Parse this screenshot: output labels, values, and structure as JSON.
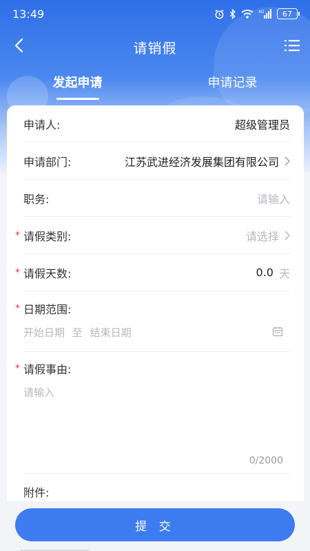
{
  "status_bar": {
    "time": "13:49",
    "battery": "67",
    "icons": [
      "alarm-icon",
      "bluetooth-icon",
      "wifi-icon",
      "signal-icon",
      "battery-icon"
    ]
  },
  "nav": {
    "title": "请销假",
    "back_icon": "chevron-left-icon",
    "menu_icon": "list-menu-icon"
  },
  "tabs": [
    {
      "label": "发起申请",
      "active": true
    },
    {
      "label": "申请记录",
      "active": false
    }
  ],
  "form": {
    "applicant": {
      "label": "申请人:",
      "value": "超级管理员"
    },
    "department": {
      "label": "申请部门:",
      "value": "江苏武进经济发展集团有限公司"
    },
    "position": {
      "label": "职务:",
      "placeholder": "请输入"
    },
    "leave_type": {
      "label": "请假类别:",
      "placeholder": "请选择",
      "required": "*"
    },
    "leave_days": {
      "label": "请假天数:",
      "value": "0.0",
      "unit": "天",
      "required": "*"
    },
    "date_range": {
      "label": "日期范围:",
      "start": "开始日期",
      "separator": "至",
      "end": "结束日期",
      "required": "*"
    },
    "reason": {
      "label": "请假事由:",
      "placeholder": "请输入",
      "counter": "0/2000",
      "required": "*"
    },
    "attachment": {
      "label": "附件:"
    }
  },
  "submit_label": "提 交",
  "colors": {
    "primary": "#3d7cf0",
    "required": "#e53935",
    "placeholder": "#b5b8be"
  }
}
